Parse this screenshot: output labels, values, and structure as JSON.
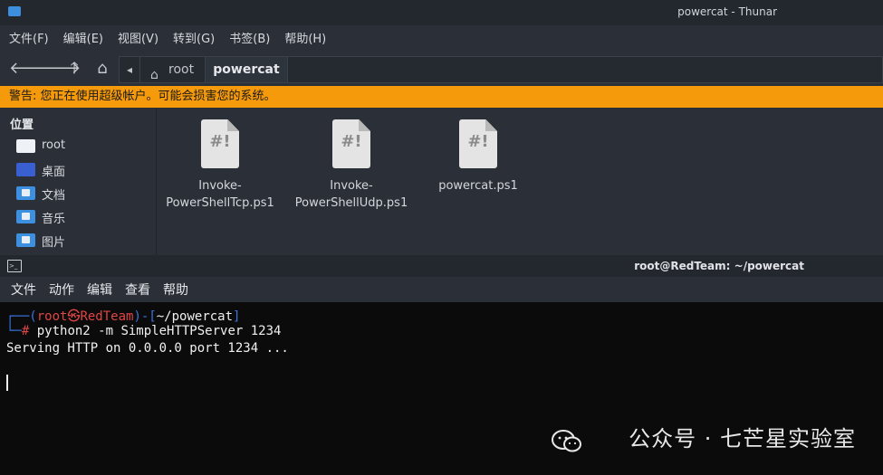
{
  "thunar": {
    "title": "powercat - Thunar",
    "menu": [
      "文件(F)",
      "编辑(E)",
      "视图(V)",
      "转到(G)",
      "书签(B)",
      "帮助(H)"
    ],
    "breadcrumb": {
      "root": "root",
      "current": "powercat"
    },
    "warning": "警告: 您正在使用超级帐户。可能会损害您的系统。",
    "sidebar": {
      "heading": "位置",
      "items": [
        {
          "label": "root",
          "icon": "home-folder-icon"
        },
        {
          "label": "桌面",
          "icon": "desktop-folder-icon"
        },
        {
          "label": "文档",
          "icon": "documents-folder-icon"
        },
        {
          "label": "音乐",
          "icon": "music-folder-icon"
        },
        {
          "label": "图片",
          "icon": "pictures-folder-icon"
        }
      ]
    },
    "files": [
      {
        "line1": "Invoke-",
        "line2": "PowerShellTcp.ps1"
      },
      {
        "line1": "Invoke-",
        "line2": "PowerShellUdp.ps1"
      },
      {
        "line1": "powercat.ps1",
        "line2": ""
      }
    ],
    "file_icon_mark": "#!"
  },
  "terminal": {
    "title": "root@RedTeam: ~/powercat",
    "menu": [
      "文件",
      "动作",
      "编辑",
      "查看",
      "帮助"
    ],
    "prompt_user": "root",
    "prompt_at": "㉿",
    "prompt_host": "RedTeam",
    "prompt_path": "~/powercat",
    "command": "python2 -m SimpleHTTPServer 1234",
    "output": "Serving HTTP on 0.0.0.0 port 1234 ..."
  },
  "watermark": "公众号 · 七芒星实验室",
  "colors": {
    "warning": "#f59a0b",
    "folder": "#3d8fe0",
    "prompt_blue": "#3a74e0",
    "prompt_red": "#e04545"
  }
}
